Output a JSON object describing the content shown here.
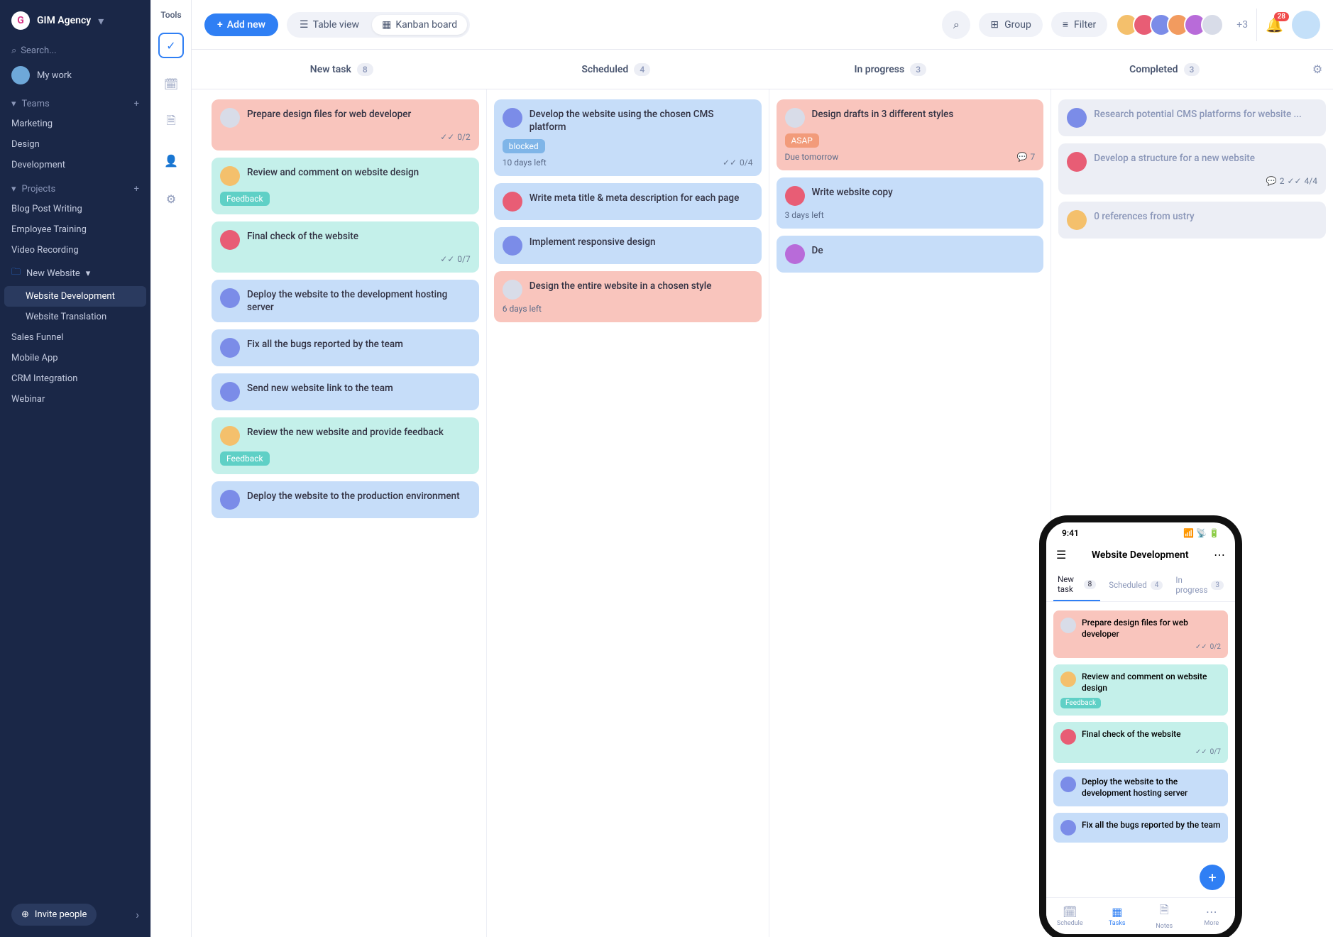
{
  "nav": {
    "org": "GIM Agency",
    "search_placeholder": "Search...",
    "my_work": "My work",
    "teams_label": "Teams",
    "teams": [
      "Marketing",
      "Design",
      "Development"
    ],
    "projects_label": "Projects",
    "projects_top": [
      "Blog Post Writing",
      "Employee Training",
      "Video Recording"
    ],
    "folder": "New Website",
    "folder_items": [
      "Website Development",
      "Website Translation"
    ],
    "projects_bottom": [
      "Sales Funnel",
      "Mobile App",
      "CRM Integration",
      "Webinar"
    ],
    "invite": "Invite people"
  },
  "rail": {
    "label": "Tools"
  },
  "toolbar": {
    "add": "Add new",
    "table": "Table view",
    "kanban": "Kanban board",
    "group": "Group",
    "filter": "Filter",
    "avatar_more": "+3",
    "notifications": "28"
  },
  "columns": [
    {
      "name": "New task",
      "count": "8"
    },
    {
      "name": "Scheduled",
      "count": "4"
    },
    {
      "name": "In progress",
      "count": "3"
    },
    {
      "name": "Completed",
      "count": "3"
    }
  ],
  "col1": [
    {
      "title": "Prepare design files for web developer",
      "color": "c-red",
      "check": "0/2",
      "av": "av6"
    },
    {
      "title": "Review and comment on website design",
      "color": "c-teal",
      "tag": "Feedback",
      "av": "av1"
    },
    {
      "title": "Final check of the website",
      "color": "c-teal",
      "check": "0/7",
      "av": "av2"
    },
    {
      "title": "Deploy the website to the development hosting server",
      "color": "c-blue",
      "av": "av3"
    },
    {
      "title": "Fix all the bugs reported by the team",
      "color": "c-blue",
      "av": "av3"
    },
    {
      "title": "Send new website link to the team",
      "color": "c-blue",
      "av": "av3"
    },
    {
      "title": "Review the new website and provide feedback",
      "color": "c-teal",
      "tag": "Feedback",
      "av": "av1"
    },
    {
      "title": "Deploy the website to the production environment",
      "color": "c-blue",
      "av": "av3"
    }
  ],
  "col2": [
    {
      "title": "Develop the website using the chosen CMS platform",
      "color": "c-blue",
      "tag": "blocked",
      "left": "10 days left",
      "check": "0/4",
      "av": "av3"
    },
    {
      "title": "Write meta title & meta description for each page",
      "color": "c-blue",
      "av": "av2"
    },
    {
      "title": "Implement responsive design",
      "color": "c-blue",
      "av": "av3"
    },
    {
      "title": "Design the entire website in a chosen style",
      "color": "c-red",
      "left": "6 days left",
      "av": "av6"
    }
  ],
  "col3": [
    {
      "title": "Design drafts in 3 different styles",
      "color": "c-red",
      "tag": "ASAP",
      "left": "Due tomorrow",
      "comments": "7",
      "av": "av6"
    },
    {
      "title": "Write website copy",
      "color": "c-blue",
      "left": "3 days left",
      "av": "av2"
    },
    {
      "title": "De",
      "color": "c-blue",
      "av": "av5"
    }
  ],
  "col4": [
    {
      "title": "Research potential CMS platforms for website ...",
      "color": "c-gray",
      "av": "av3"
    },
    {
      "title": "Develop a structure for a new website",
      "color": "c-gray",
      "comments": "2",
      "check": "4/4",
      "av": "av2"
    },
    {
      "title": "0 references from ustry",
      "color": "c-gray",
      "av": "av1"
    }
  ],
  "phone": {
    "time": "9:41",
    "title": "Website Development",
    "tabs": [
      {
        "label": "New task",
        "count": "8"
      },
      {
        "label": "Scheduled",
        "count": "4"
      },
      {
        "label": "In progress",
        "count": "3"
      }
    ],
    "cards": [
      {
        "title": "Prepare design files for web developer",
        "color": "c-red",
        "check": "0/2",
        "av": "av6"
      },
      {
        "title": "Review and comment on website design",
        "color": "c-teal",
        "tag": "Feedback",
        "av": "av1"
      },
      {
        "title": "Final check of the website",
        "color": "c-teal",
        "check": "0/7",
        "av": "av2"
      },
      {
        "title": "Deploy the website to the development hosting server",
        "color": "c-blue",
        "av": "av3"
      },
      {
        "title": "Fix all the bugs reported by the team",
        "color": "c-blue",
        "av": "av3"
      }
    ],
    "nav": [
      "Schedule",
      "Tasks",
      "Notes",
      "More"
    ]
  }
}
